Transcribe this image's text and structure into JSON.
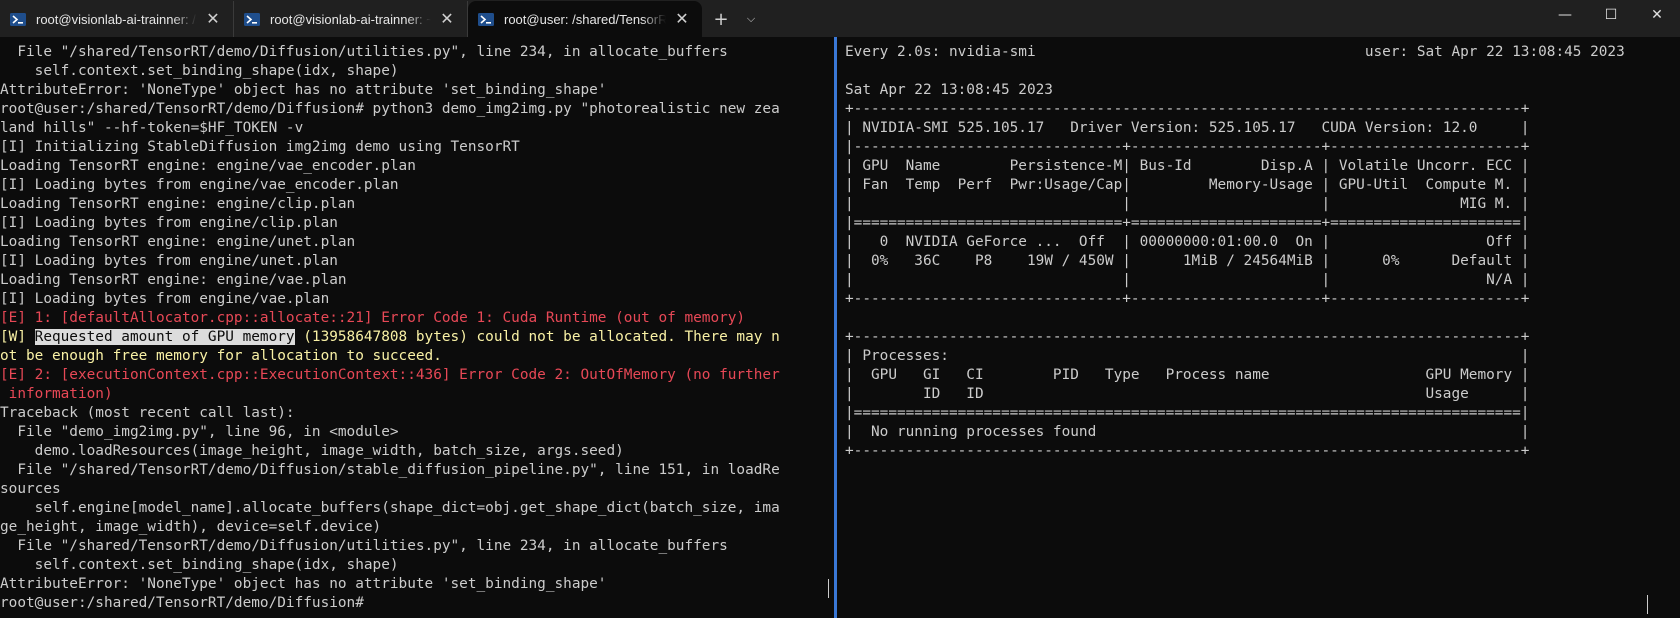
{
  "tabs": [
    {
      "label": "root@visionlab-ai-trainner: /sh",
      "active": false,
      "icon": "powershell-icon"
    },
    {
      "label": "root@visionlab-ai-trainner: ~",
      "active": false,
      "icon": "powershell-icon"
    },
    {
      "label": "root@user: /shared/TensorRT/",
      "active": true,
      "icon": "powershell-icon"
    }
  ],
  "tabbar": {
    "new_tab": "+",
    "dropdown": "⌵",
    "close": "✕"
  },
  "window_controls": {
    "minimize": "—",
    "maximize": "☐",
    "close": "✕"
  },
  "left_pane": {
    "lines": [
      {
        "text": "  File \"/shared/TensorRT/demo/Diffusion/utilities.py\", line 234, in allocate_buffers",
        "style": "normal"
      },
      {
        "text": "    self.context.set_binding_shape(idx, shape)",
        "style": "normal"
      },
      {
        "text": "AttributeError: 'NoneType' object has no attribute 'set_binding_shape'",
        "style": "normal"
      },
      {
        "text": "root@user:/shared/TensorRT/demo/Diffusion# python3 demo_img2img.py \"photorealistic new zea",
        "style": "normal"
      },
      {
        "text": "land hills\" --hf-token=$HF_TOKEN -v",
        "style": "normal"
      },
      {
        "text": "[I] Initializing StableDiffusion img2img demo using TensorRT",
        "style": "normal"
      },
      {
        "text": "Loading TensorRT engine: engine/vae_encoder.plan",
        "style": "normal"
      },
      {
        "text": "[I] Loading bytes from engine/vae_encoder.plan",
        "style": "normal"
      },
      {
        "text": "Loading TensorRT engine: engine/clip.plan",
        "style": "normal"
      },
      {
        "text": "[I] Loading bytes from engine/clip.plan",
        "style": "normal"
      },
      {
        "text": "Loading TensorRT engine: engine/unet.plan",
        "style": "normal"
      },
      {
        "text": "[I] Loading bytes from engine/unet.plan",
        "style": "normal"
      },
      {
        "text": "Loading TensorRT engine: engine/vae.plan",
        "style": "normal"
      },
      {
        "text": "[I] Loading bytes from engine/vae.plan",
        "style": "normal"
      },
      {
        "text": "[E] 1: [defaultAllocator.cpp::allocate::21] Error Code 1: Cuda Runtime (out of memory)",
        "style": "err"
      },
      {
        "text": "",
        "style": "warn-hl",
        "pre": "[W] ",
        "highlight": "Requested amount of GPU memory",
        "post": " (13958647808 bytes) could not be allocated. There may n"
      },
      {
        "text": "ot be enough free memory for allocation to succeed.",
        "style": "warn"
      },
      {
        "text": "[E] 2: [executionContext.cpp::ExecutionContext::436] Error Code 2: OutOfMemory (no further",
        "style": "err"
      },
      {
        "text": " information)",
        "style": "err"
      },
      {
        "text": "Traceback (most recent call last):",
        "style": "normal"
      },
      {
        "text": "  File \"demo_img2img.py\", line 96, in <module>",
        "style": "normal"
      },
      {
        "text": "    demo.loadResources(image_height, image_width, batch_size, args.seed)",
        "style": "normal"
      },
      {
        "text": "  File \"/shared/TensorRT/demo/Diffusion/stable_diffusion_pipeline.py\", line 151, in loadRe",
        "style": "normal"
      },
      {
        "text": "sources",
        "style": "normal"
      },
      {
        "text": "    self.engine[model_name].allocate_buffers(shape_dict=obj.get_shape_dict(batch_size, ima",
        "style": "normal"
      },
      {
        "text": "ge_height, image_width), device=self.device)",
        "style": "normal"
      },
      {
        "text": "  File \"/shared/TensorRT/demo/Diffusion/utilities.py\", line 234, in allocate_buffers",
        "style": "normal"
      },
      {
        "text": "    self.context.set_binding_shape(idx, shape)",
        "style": "normal"
      },
      {
        "text": "AttributeError: 'NoneType' object has no attribute 'set_binding_shape'",
        "style": "normal"
      },
      {
        "text": "root@user:/shared/TensorRT/demo/Diffusion#",
        "style": "normal"
      }
    ]
  },
  "right_pane": {
    "lines": [
      "Every 2.0s: nvidia-smi                                      user: Sat Apr 22 13:08:45 2023",
      "",
      "Sat Apr 22 13:08:45 2023",
      "+-----------------------------------------------------------------------------+",
      "| NVIDIA-SMI 525.105.17   Driver Version: 525.105.17   CUDA Version: 12.0     |",
      "|-------------------------------+----------------------+----------------------+",
      "| GPU  Name        Persistence-M| Bus-Id        Disp.A | Volatile Uncorr. ECC |",
      "| Fan  Temp  Perf  Pwr:Usage/Cap|         Memory-Usage | GPU-Util  Compute M. |",
      "|                               |                      |               MIG M. |",
      "|===============================+======================+======================|",
      "|   0  NVIDIA GeForce ...  Off  | 00000000:01:00.0  On |                  Off |",
      "|  0%   36C    P8    19W / 450W |      1MiB / 24564MiB |      0%      Default |",
      "|                               |                      |                  N/A |",
      "+-------------------------------+----------------------+----------------------+",
      "",
      "+-----------------------------------------------------------------------------+",
      "| Processes:                                                                  |",
      "|  GPU   GI   CI        PID   Type   Process name                  GPU Memory |",
      "|        ID   ID                                                   Usage      |",
      "|=============================================================================|",
      "|  No running processes found                                                 |",
      "+-----------------------------------------------------------------------------+"
    ]
  },
  "colors": {
    "background": "#0c0c0c",
    "text": "#cccccc",
    "error": "#e74856",
    "warning": "#f9f1a5",
    "pane_divider": "#3a78d6",
    "tabbar": "#202020"
  }
}
